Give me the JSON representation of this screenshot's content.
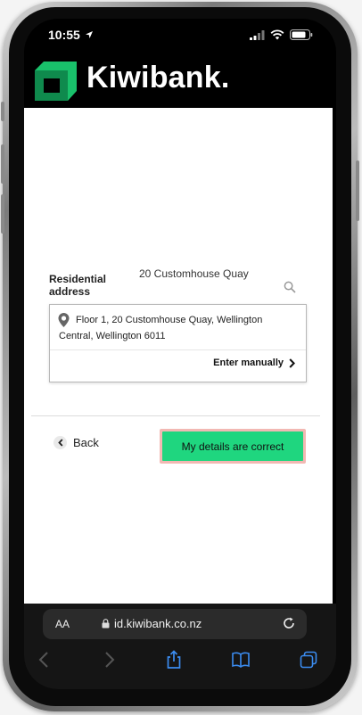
{
  "status_bar": {
    "time": "10:55"
  },
  "brand": {
    "name": "Kiwibank.",
    "accent": "#1fd67f",
    "dark_green": "#0f8a4d"
  },
  "address_form": {
    "label": "Residential address",
    "query": "20 Customhouse Quay",
    "search_icon": "search-icon",
    "suggestion": {
      "line1": "Floor 1, 20 Customhouse Quay, Wellington",
      "line2": "Central, Wellington 6011"
    },
    "enter_manually_label": "Enter manually"
  },
  "actions": {
    "back_label": "Back",
    "confirm_label": "My details are correct"
  },
  "browser": {
    "aa_label": "AA",
    "url": "id.kiwibank.co.nz"
  }
}
